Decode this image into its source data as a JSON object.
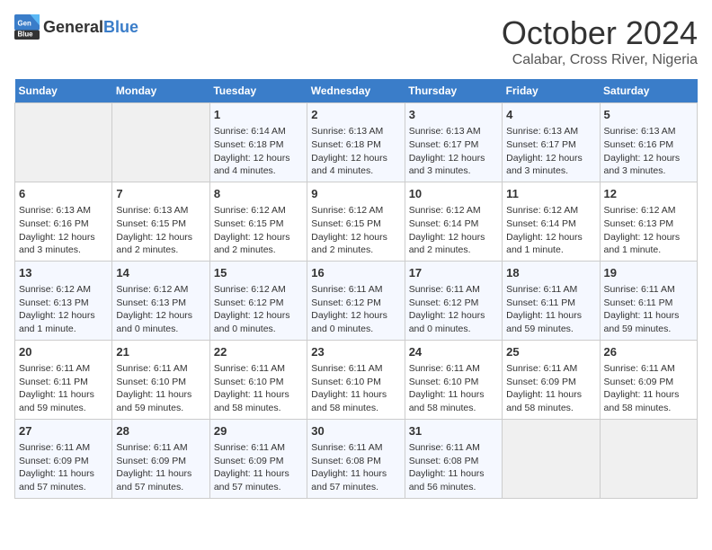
{
  "logo": {
    "general": "General",
    "blue": "Blue"
  },
  "title": "October 2024",
  "subtitle": "Calabar, Cross River, Nigeria",
  "days_of_week": [
    "Sunday",
    "Monday",
    "Tuesday",
    "Wednesday",
    "Thursday",
    "Friday",
    "Saturday"
  ],
  "weeks": [
    [
      {
        "day": "",
        "info": ""
      },
      {
        "day": "",
        "info": ""
      },
      {
        "day": "1",
        "info": "Sunrise: 6:14 AM\nSunset: 6:18 PM\nDaylight: 12 hours and 4 minutes."
      },
      {
        "day": "2",
        "info": "Sunrise: 6:13 AM\nSunset: 6:18 PM\nDaylight: 12 hours and 4 minutes."
      },
      {
        "day": "3",
        "info": "Sunrise: 6:13 AM\nSunset: 6:17 PM\nDaylight: 12 hours and 3 minutes."
      },
      {
        "day": "4",
        "info": "Sunrise: 6:13 AM\nSunset: 6:17 PM\nDaylight: 12 hours and 3 minutes."
      },
      {
        "day": "5",
        "info": "Sunrise: 6:13 AM\nSunset: 6:16 PM\nDaylight: 12 hours and 3 minutes."
      }
    ],
    [
      {
        "day": "6",
        "info": "Sunrise: 6:13 AM\nSunset: 6:16 PM\nDaylight: 12 hours and 3 minutes."
      },
      {
        "day": "7",
        "info": "Sunrise: 6:13 AM\nSunset: 6:15 PM\nDaylight: 12 hours and 2 minutes."
      },
      {
        "day": "8",
        "info": "Sunrise: 6:12 AM\nSunset: 6:15 PM\nDaylight: 12 hours and 2 minutes."
      },
      {
        "day": "9",
        "info": "Sunrise: 6:12 AM\nSunset: 6:15 PM\nDaylight: 12 hours and 2 minutes."
      },
      {
        "day": "10",
        "info": "Sunrise: 6:12 AM\nSunset: 6:14 PM\nDaylight: 12 hours and 2 minutes."
      },
      {
        "day": "11",
        "info": "Sunrise: 6:12 AM\nSunset: 6:14 PM\nDaylight: 12 hours and 1 minute."
      },
      {
        "day": "12",
        "info": "Sunrise: 6:12 AM\nSunset: 6:13 PM\nDaylight: 12 hours and 1 minute."
      }
    ],
    [
      {
        "day": "13",
        "info": "Sunrise: 6:12 AM\nSunset: 6:13 PM\nDaylight: 12 hours and 1 minute."
      },
      {
        "day": "14",
        "info": "Sunrise: 6:12 AM\nSunset: 6:13 PM\nDaylight: 12 hours and 0 minutes."
      },
      {
        "day": "15",
        "info": "Sunrise: 6:12 AM\nSunset: 6:12 PM\nDaylight: 12 hours and 0 minutes."
      },
      {
        "day": "16",
        "info": "Sunrise: 6:11 AM\nSunset: 6:12 PM\nDaylight: 12 hours and 0 minutes."
      },
      {
        "day": "17",
        "info": "Sunrise: 6:11 AM\nSunset: 6:12 PM\nDaylight: 12 hours and 0 minutes."
      },
      {
        "day": "18",
        "info": "Sunrise: 6:11 AM\nSunset: 6:11 PM\nDaylight: 11 hours and 59 minutes."
      },
      {
        "day": "19",
        "info": "Sunrise: 6:11 AM\nSunset: 6:11 PM\nDaylight: 11 hours and 59 minutes."
      }
    ],
    [
      {
        "day": "20",
        "info": "Sunrise: 6:11 AM\nSunset: 6:11 PM\nDaylight: 11 hours and 59 minutes."
      },
      {
        "day": "21",
        "info": "Sunrise: 6:11 AM\nSunset: 6:10 PM\nDaylight: 11 hours and 59 minutes."
      },
      {
        "day": "22",
        "info": "Sunrise: 6:11 AM\nSunset: 6:10 PM\nDaylight: 11 hours and 58 minutes."
      },
      {
        "day": "23",
        "info": "Sunrise: 6:11 AM\nSunset: 6:10 PM\nDaylight: 11 hours and 58 minutes."
      },
      {
        "day": "24",
        "info": "Sunrise: 6:11 AM\nSunset: 6:10 PM\nDaylight: 11 hours and 58 minutes."
      },
      {
        "day": "25",
        "info": "Sunrise: 6:11 AM\nSunset: 6:09 PM\nDaylight: 11 hours and 58 minutes."
      },
      {
        "day": "26",
        "info": "Sunrise: 6:11 AM\nSunset: 6:09 PM\nDaylight: 11 hours and 58 minutes."
      }
    ],
    [
      {
        "day": "27",
        "info": "Sunrise: 6:11 AM\nSunset: 6:09 PM\nDaylight: 11 hours and 57 minutes."
      },
      {
        "day": "28",
        "info": "Sunrise: 6:11 AM\nSunset: 6:09 PM\nDaylight: 11 hours and 57 minutes."
      },
      {
        "day": "29",
        "info": "Sunrise: 6:11 AM\nSunset: 6:09 PM\nDaylight: 11 hours and 57 minutes."
      },
      {
        "day": "30",
        "info": "Sunrise: 6:11 AM\nSunset: 6:08 PM\nDaylight: 11 hours and 57 minutes."
      },
      {
        "day": "31",
        "info": "Sunrise: 6:11 AM\nSunset: 6:08 PM\nDaylight: 11 hours and 56 minutes."
      },
      {
        "day": "",
        "info": ""
      },
      {
        "day": "",
        "info": ""
      }
    ]
  ]
}
